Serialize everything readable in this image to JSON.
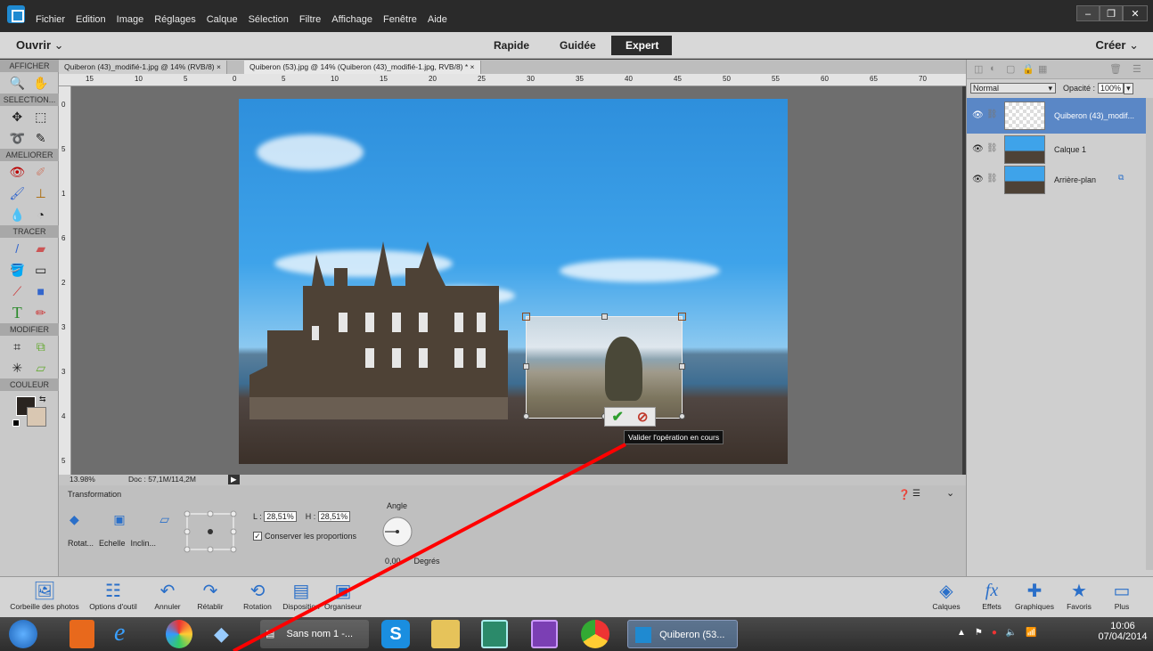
{
  "menu": [
    "Fichier",
    "Edition",
    "Image",
    "Réglages",
    "Calque",
    "Sélection",
    "Filtre",
    "Affichage",
    "Fenêtre",
    "Aide"
  ],
  "window_controls": {
    "minimize": "–",
    "maximize": "❐",
    "close": "✕"
  },
  "modebar": {
    "open": "Ouvrir",
    "create": "Créer",
    "modes": [
      "Rapide",
      "Guidée",
      "Expert"
    ]
  },
  "toolbox": {
    "sections": [
      "AFFICHER",
      "SELECTION...",
      "AMELIORER",
      "TRACER",
      "MODIFIER",
      "COULEUR"
    ]
  },
  "tabs": [
    "Quiberon (43)_modifié-1.jpg @ 14% (RVB/8) ×",
    "Quiberon (53).jpg @ 14% (Quiberon (43)_modifié-1.jpg, RVB/8) * ×"
  ],
  "ruler_h": [
    "15",
    "10",
    "5",
    "0",
    "5",
    "10",
    "15",
    "20",
    "25",
    "30",
    "35",
    "40",
    "45",
    "50",
    "55",
    "60",
    "65",
    "70"
  ],
  "ruler_v": [
    "0",
    "5",
    "1",
    "6",
    "2",
    "3",
    "3",
    "4",
    "5"
  ],
  "status": {
    "zoom": "13.98%",
    "doc": "Doc : 57,1M/114,2M",
    "arrow": "▶"
  },
  "tooltip": "Valider l'opération en cours",
  "options": {
    "title": "Transformation",
    "tools": [
      "Rotat...",
      "Echelle",
      "Inclin..."
    ],
    "width_label": "L :",
    "width_value": "28,51%",
    "height_label": "H :",
    "height_value": "28,51%",
    "keep_proportions": "Conserver les proportions",
    "angle_label": "Angle",
    "angle_value": "0,00",
    "degrees": "Degrés"
  },
  "layers_panel": {
    "blend_mode": "Normal",
    "opacity_label": "Opacité :",
    "opacity_value": "100%",
    "layers": [
      {
        "name": "Quiberon (43)_modif...",
        "selected": true
      },
      {
        "name": "Calque 1",
        "selected": false
      },
      {
        "name": "Arrière-plan",
        "selected": false
      }
    ]
  },
  "bottombar": {
    "left": [
      "Corbeille des photos",
      "Options d'outil",
      "Annuler",
      "Rétablir",
      "Rotation",
      "Disposition",
      "Organiseur"
    ],
    "right": [
      "Calques",
      "Effets",
      "Graphiques",
      "Favoris",
      "Plus"
    ]
  },
  "taskbar": {
    "apps": [
      "Sans nom 1 -...",
      "Quiberon (53..."
    ],
    "time": "10:06",
    "date": "07/04/2014"
  },
  "colors": {
    "selected_layer": "#5a87c6",
    "annotation_line": "#ff0000",
    "commit_check": "#2e9e2e",
    "cancel": "#c0392b"
  }
}
